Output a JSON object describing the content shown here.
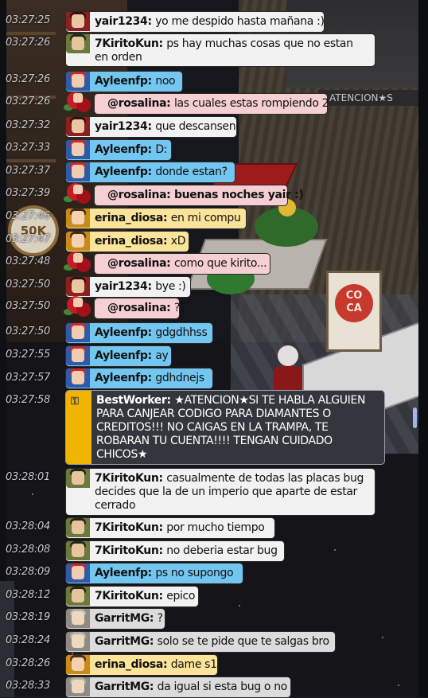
{
  "room": {
    "sign_50k": "50K",
    "banner_text": "CO\nCA",
    "marquee": "ATENCION★S"
  },
  "chat": [
    {
      "time": "03:27:25",
      "user": "yair1234",
      "avatar": "yair",
      "color": "white",
      "text": "yo me despido hasta mañana :)"
    },
    {
      "time": "03:27:26",
      "user": "7KiritoKun",
      "avatar": "kirito",
      "color": "white",
      "text": "ps hay muchas cosas que no estan en orden"
    },
    {
      "time": "03:27:26",
      "user": "Ayleenfp",
      "avatar": "ayleen",
      "color": "blue",
      "text": "noo"
    },
    {
      "time": "03:27:26",
      "user": "@rosalina",
      "avatar": "rosalina",
      "color": "pink",
      "text": "las cuales estas rompiendo 2"
    },
    {
      "time": "03:27:32",
      "user": "yair1234",
      "avatar": "yair",
      "color": "white",
      "text": "que descansen"
    },
    {
      "time": "03:27:33",
      "user": "Ayleenfp",
      "avatar": "ayleen",
      "color": "blue",
      "text": "D:"
    },
    {
      "time": "03:27:37",
      "user": "Ayleenfp",
      "avatar": "ayleen",
      "color": "blue",
      "text": "donde estan?"
    },
    {
      "time": "03:27:39",
      "user": "@rosalina",
      "avatar": "rosalina",
      "color": "pink",
      "text": "buenas noches yair :)",
      "bold_text": true
    },
    {
      "time": "03:27:46",
      "user": "erina_diosa",
      "avatar": "erina",
      "color": "yellow",
      "text": "en mi compu"
    },
    {
      "time": "03:27:47",
      "user": "erina_diosa",
      "avatar": "erina",
      "color": "yellow",
      "text": "xD"
    },
    {
      "time": "03:27:48",
      "user": "@rosalina",
      "avatar": "rosalina",
      "color": "pink",
      "text": "como que kirito..."
    },
    {
      "time": "03:27:50",
      "user": "yair1234",
      "avatar": "yair",
      "color": "white",
      "text": "bye :)"
    },
    {
      "time": "03:27:50",
      "user": "@rosalina",
      "avatar": "rosalina",
      "color": "pink",
      "text": "??"
    },
    {
      "time": "03:27:50",
      "user": "Ayleenfp",
      "avatar": "ayleen",
      "color": "blue",
      "text": "gdgdhhss"
    },
    {
      "time": "03:27:55",
      "user": "Ayleenfp",
      "avatar": "ayleen",
      "color": "blue",
      "text": "ay"
    },
    {
      "time": "03:27:57",
      "user": "Ayleenfp",
      "avatar": "ayleen",
      "color": "blue",
      "text": "gdhdnejs"
    },
    {
      "time": "03:27:58",
      "user": "BestWorker",
      "avatar": "bot",
      "color": "bot",
      "text": "★ATENCION★SI TE HABLA ALGUIEN PARA CANJEAR CODIGO PARA DIAMANTES O CREDITOS!!! NO CAIGAS EN LA TRAMPA, TE ROBARAN TU CUENTA!!!! TENGAN CUIDADO CHICOS★"
    },
    {
      "time": "03:28:01",
      "user": "7KiritoKun",
      "avatar": "kirito",
      "color": "white",
      "text": "casualmente de todas las placas bug decides que la de un imperio que aparte de estar cerrado"
    },
    {
      "time": "03:28:04",
      "user": "7KiritoKun",
      "avatar": "kirito",
      "color": "white",
      "text": "por mucho tiempo"
    },
    {
      "time": "03:28:08",
      "user": "7KiritoKun",
      "avatar": "kirito",
      "color": "white",
      "text": "no deberia estar bug"
    },
    {
      "time": "03:28:09",
      "user": "Ayleenfp",
      "avatar": "ayleen",
      "color": "blue",
      "text": "ps no supongo"
    },
    {
      "time": "03:28:12",
      "user": "7KiritoKun",
      "avatar": "kirito",
      "color": "white",
      "text": "epico"
    },
    {
      "time": "03:28:19",
      "user": "GarritMG",
      "avatar": "garrit",
      "color": "gray",
      "text": "?"
    },
    {
      "time": "03:28:24",
      "user": "GarritMG",
      "avatar": "garrit",
      "color": "gray",
      "text": "solo se te pide que te salgas bro"
    },
    {
      "time": "03:28:26",
      "user": "erina_diosa",
      "avatar": "erina",
      "color": "yellow",
      "text": "dame s1"
    },
    {
      "time": "03:28:33",
      "user": "GarritMG",
      "avatar": "garrit",
      "color": "gray",
      "text": "da igual si esta bug o no"
    }
  ]
}
